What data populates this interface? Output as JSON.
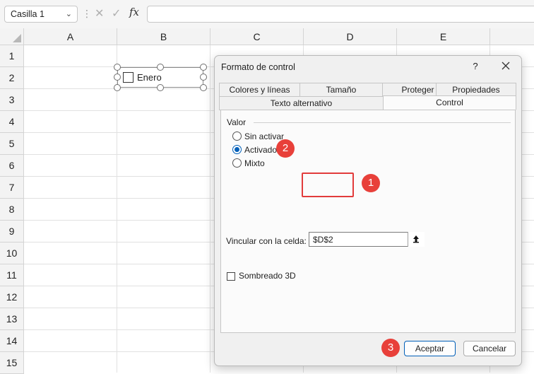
{
  "formula_bar": {
    "name_box": "Casilla 1",
    "fx_label": "fx",
    "formula_value": ""
  },
  "sheet": {
    "columns": [
      "A",
      "B",
      "C",
      "D",
      "E"
    ],
    "rows": [
      "1",
      "2",
      "3",
      "4",
      "5",
      "6",
      "7",
      "8",
      "9",
      "10",
      "11",
      "12",
      "13",
      "14",
      "15"
    ]
  },
  "checkbox_control": {
    "label": "Enero",
    "checked": false
  },
  "dialog": {
    "title": "Formato de control",
    "help_label": "?",
    "tabs_row_top": [
      "Colores y líneas",
      "Tamaño",
      "Proteger",
      "Propiedades"
    ],
    "tabs_row_bottom": [
      "Texto alternativo",
      "Control"
    ],
    "active_tab": "Control",
    "value_group": {
      "label": "Valor",
      "options": [
        "Sin activar",
        "Activado",
        "Mixto"
      ],
      "selected": "Activado"
    },
    "link_cell": {
      "label": "Vincular con la celda:",
      "value": "$D$2"
    },
    "shading": {
      "label": "Sombreado 3D",
      "checked": false
    },
    "buttons": {
      "ok": "Aceptar",
      "cancel": "Cancelar"
    }
  },
  "annotations": {
    "badges": [
      "1",
      "2",
      "3"
    ],
    "color": "#e8403a"
  },
  "colors": {
    "accent": "#005fb8",
    "dialog_bg": "#f0f0f0",
    "header_bg": "#f3f3f3"
  }
}
